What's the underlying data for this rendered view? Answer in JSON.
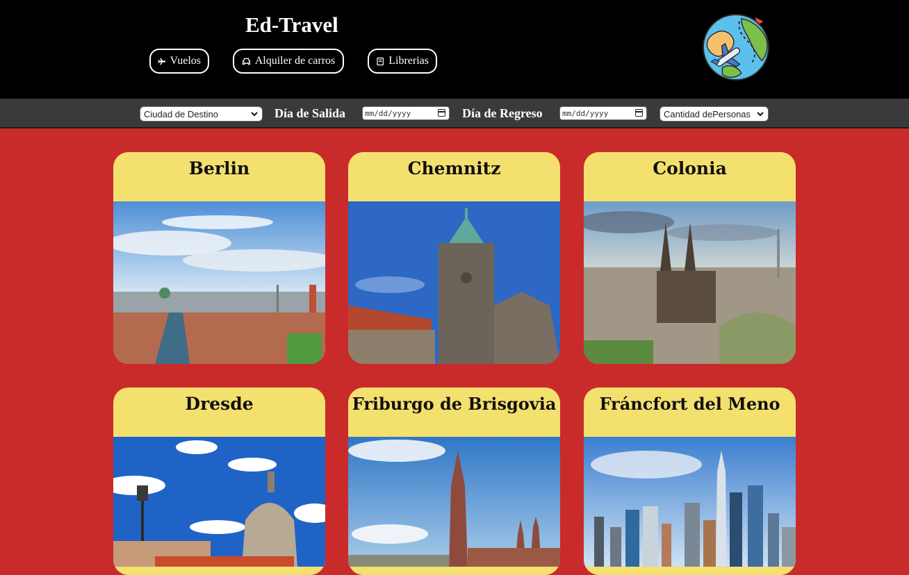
{
  "app": {
    "brand": "Ed-Travel",
    "nav": [
      {
        "label": "Vuelos",
        "icon": "airplane-icon"
      },
      {
        "label": "Alquiler de carros",
        "icon": "car-icon"
      },
      {
        "label": "Librerias",
        "icon": "book-icon"
      }
    ],
    "logo_icon": "globe-travel-icon"
  },
  "filters": {
    "destination": "Ciudad de Destino",
    "departure_label": "Día de Salida",
    "departure_value": "mm/dd/yyyy",
    "return_label": "Día de Regreso",
    "return_value": "mm/dd/yyyy",
    "people": "Cantidad dePersonas"
  },
  "colors": {
    "page_bg": "#c92b2b",
    "header_bg": "#000000",
    "filter_bg": "#3a3a3a",
    "card_header": "#f4e06e"
  },
  "cities": [
    {
      "name": "Berlin"
    },
    {
      "name": "Chemnitz"
    },
    {
      "name": "Colonia"
    },
    {
      "name": "Dresde"
    },
    {
      "name": "Friburgo de Brisgovia"
    },
    {
      "name": "Fráncfort del Meno"
    }
  ]
}
